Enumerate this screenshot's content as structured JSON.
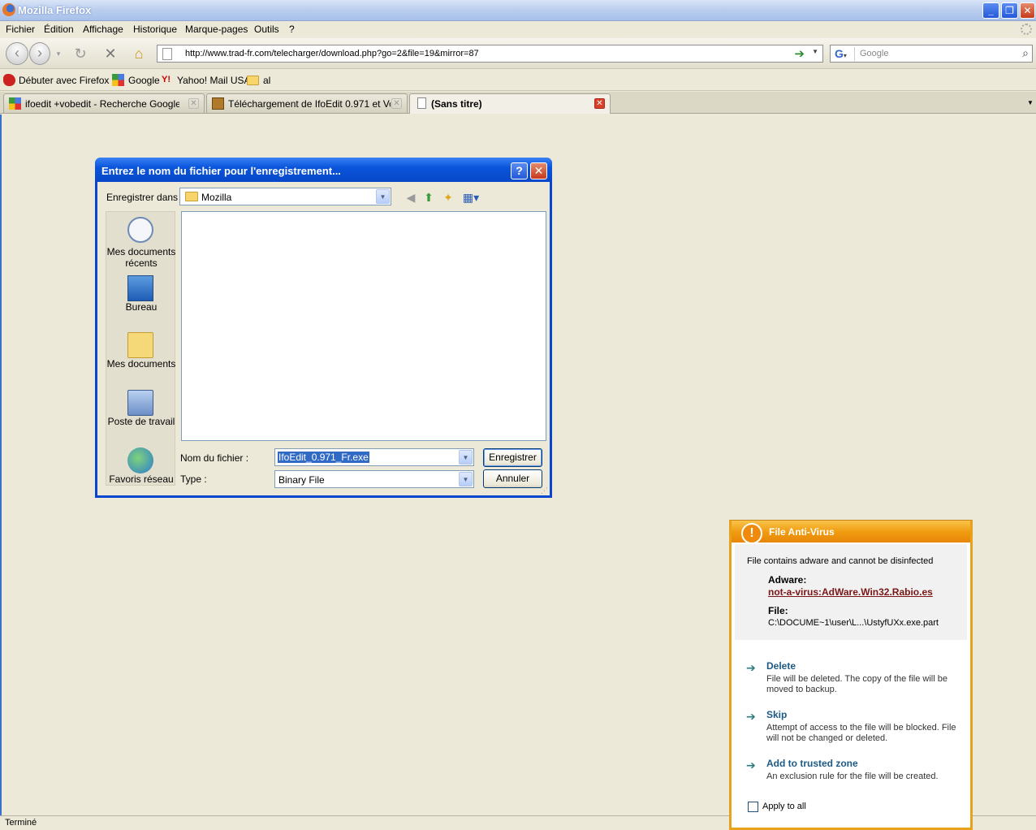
{
  "window": {
    "title": "Mozilla Firefox"
  },
  "menu": [
    "Fichier",
    "Édition",
    "Affichage",
    "Historique",
    "Marque-pages",
    "Outils",
    "?"
  ],
  "nav": {
    "url": "http://www.trad-fr.com/telecharger/download.php?go=2&file=19&mirror=87",
    "search_placeholder": "Google"
  },
  "bookmarks": [
    "Débuter avec Firefox",
    "Google",
    "Yahoo! Mail USA",
    "al"
  ],
  "tabs": [
    {
      "label": "ifoedit +vobedit - Recherche Google",
      "active": false
    },
    {
      "label": "Téléchargement de IfoEdit 0.971 et Vo...",
      "active": false
    },
    {
      "label": "(Sans titre)",
      "active": true
    }
  ],
  "status": "Terminé",
  "save_dialog": {
    "title": "Entrez le nom du fichier pour l'enregistrement...",
    "save_in_label": "Enregistrer dans :",
    "save_in_value": "Mozilla",
    "places": [
      "Mes documents récents",
      "Bureau",
      "Mes documents",
      "Poste de travail",
      "Favoris réseau"
    ],
    "filename_label": "Nom du fichier :",
    "filename_value": "IfoEdit_0.971_Fr.exe",
    "type_label": "Type :",
    "type_value": "Binary File",
    "save_button": "Enregistrer",
    "cancel_button": "Annuler"
  },
  "antivirus": {
    "title": "File Anti-Virus",
    "message": "File contains adware and cannot be disinfected",
    "adware_label": "Adware:",
    "adware_name": "not-a-virus:AdWare.Win32.Rabio.es",
    "file_label": "File:",
    "file_path": "C:\\DOCUME~1\\user\\L...\\UstyfUXx.exe.part",
    "actions": [
      {
        "title": "Delete",
        "desc": "File will be deleted. The copy of the file will be moved to backup."
      },
      {
        "title": "Skip",
        "desc": "Attempt of access to the file will be blocked. File will not be changed or deleted."
      },
      {
        "title": "Add to trusted zone",
        "desc": "An exclusion rule for the file will be created."
      }
    ],
    "apply_all": "Apply to all"
  }
}
